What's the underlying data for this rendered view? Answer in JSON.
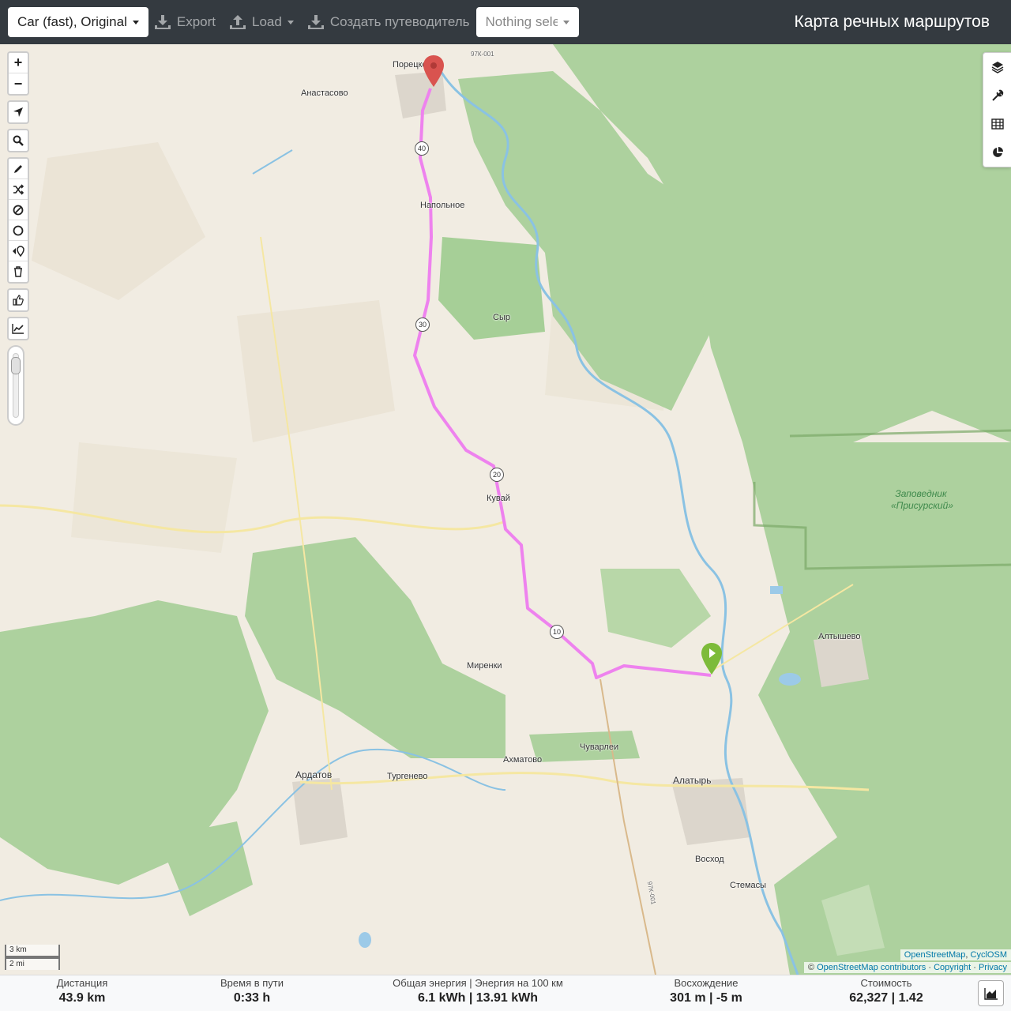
{
  "toolbar": {
    "profile": "Car (fast), Original",
    "export": "Export",
    "load": "Load",
    "guide": "Создать путеводитель",
    "selection": "Nothing selected"
  },
  "app_title": "Карта речных маршрутов",
  "map": {
    "places": {
      "poretskoe": "Порецкое",
      "anastasovo": "Анастасово",
      "napolnoe": "Напольное",
      "syr": "Сыр",
      "kuvay": "Кувай",
      "mirenki": "Миренки",
      "altyshevo": "Алтышево",
      "chuvarlei": "Чуварлеи",
      "akhmatovo": "Ахматово",
      "ardatov": "Ардатов",
      "turgenevo": "Тургенево",
      "alatyr": "Алатырь",
      "voskhod": "Восход",
      "stemasy": "Стемасы"
    },
    "reserve_label": "Заповедник «Присурский»",
    "road_shields": [
      "40",
      "30",
      "20",
      "10"
    ],
    "road_code_top": "97К-001",
    "road_code_bottom": "97К-001"
  },
  "controls": {
    "zoom_in": "+",
    "zoom_out": "−",
    "left_icons": [
      "locate-icon",
      "search-icon",
      "pencil-icon",
      "shuffle-icon",
      "no-entry-icon",
      "circle-icon",
      "delete-point-icon",
      "trash-icon",
      "thumbs-up-icon",
      "line-chart-icon"
    ],
    "right_icons": [
      "layers-icon",
      "wrench-icon",
      "table-icon",
      "pie-chart-icon"
    ],
    "slider_level": 0.15
  },
  "scale": {
    "metric": "3 km",
    "imperial": "2 mi"
  },
  "attribution": {
    "tiles_osm": "OpenStreetMap",
    "tiles_sep": ", ",
    "tiles_cyclosm": "CyclOSM",
    "copy": "© ",
    "contributors": "OpenStreetMap contributors",
    "copyright": "Copyright",
    "privacy": "Privacy",
    "sep": " · "
  },
  "stats": {
    "distance_label": "Дистанция",
    "distance_value": "43.9 km",
    "time_label": "Время в пути",
    "time_value": "0:33 h",
    "energy_label": "Общая энергия | Энергия на 100 км",
    "energy_value": "6.1 kWh | 13.91 kWh",
    "ascent_label": "Восхождение",
    "ascent_value": "301 m | -5 m",
    "cost_label": "Стоимость",
    "cost_value": "62,327 | 1.42"
  },
  "colors": {
    "route": "#ee82ee",
    "start_marker": "#d9534f",
    "end_marker": "#7dbb3a",
    "forest": "#add19e",
    "water": "#9ccae8",
    "topbar": "#343a40"
  }
}
